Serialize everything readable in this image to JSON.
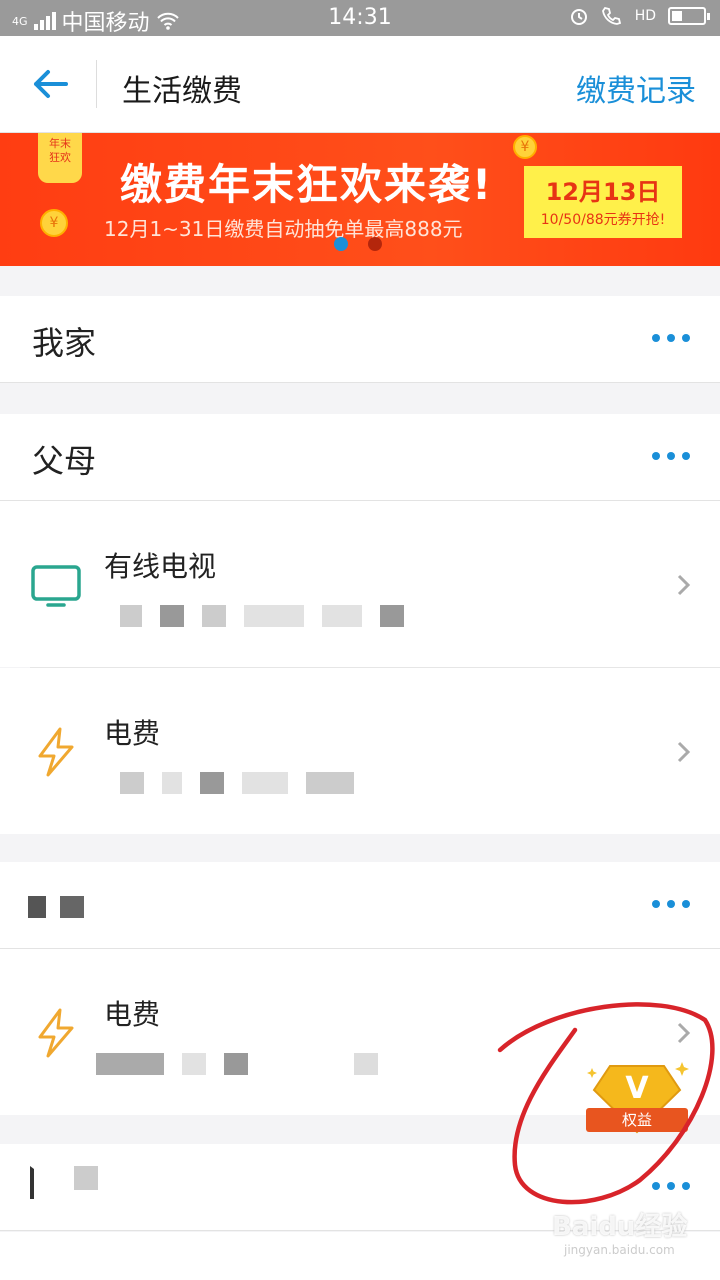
{
  "status_bar": {
    "network": "4G",
    "carrier": "中国移动",
    "time": "14:31",
    "hd": "HD"
  },
  "header": {
    "title": "生活缴费",
    "right_action": "缴费记录"
  },
  "banner": {
    "corner_tag_line1": "年末",
    "corner_tag_line2": "狂欢",
    "headline": "缴费年末狂欢来袭!",
    "subline": "12月1~31日缴费自动抽免单最高888元",
    "promo_date": "12月13日",
    "promo_text": "10/50/88元券开抢!",
    "active_dot": 0,
    "dot_count": 2
  },
  "groups": [
    {
      "name": "我家",
      "items": []
    },
    {
      "name": "父母",
      "items": [
        {
          "name": "有线电视",
          "icon": "tv-icon"
        },
        {
          "name": "电费",
          "icon": "lightning-icon"
        }
      ]
    },
    {
      "name": "",
      "items": [
        {
          "name": "电费",
          "icon": "lightning-icon"
        }
      ]
    },
    {
      "name": "",
      "items": []
    }
  ],
  "floating_badge": {
    "label": "权益",
    "letter": "V"
  },
  "watermark": {
    "brand": "Baidu经验",
    "url": "jingyan.baidu.com"
  },
  "colors": {
    "accent": "#1a8fd8",
    "banner": "#ff4f1a",
    "promo_bg": "#fff04a"
  }
}
